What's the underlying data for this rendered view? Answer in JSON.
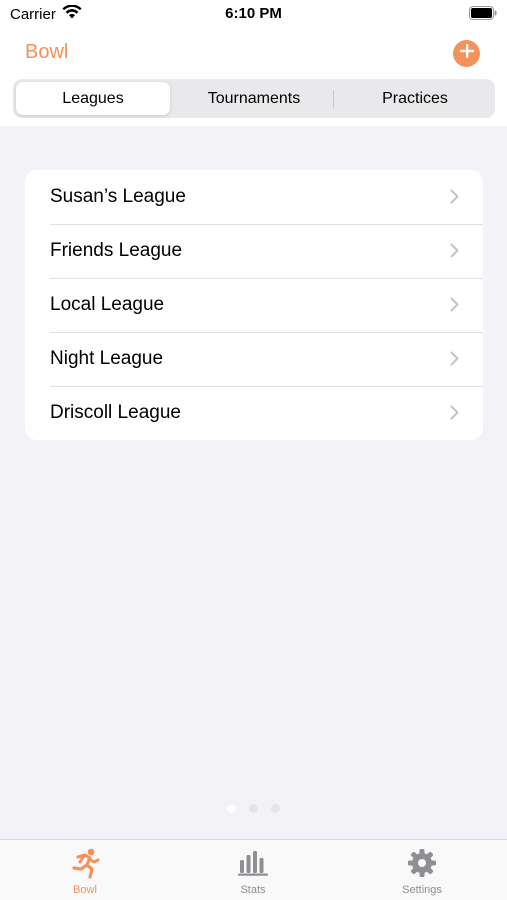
{
  "status_bar": {
    "carrier": "Carrier",
    "time": "6:10 PM"
  },
  "nav": {
    "title": "Bowl",
    "add_icon": "plus-circle-icon"
  },
  "segments": [
    {
      "label": "Leagues",
      "selected": true
    },
    {
      "label": "Tournaments",
      "selected": false
    },
    {
      "label": "Practices",
      "selected": false
    }
  ],
  "leagues": [
    {
      "label": "Susan’s League"
    },
    {
      "label": "Friends League"
    },
    {
      "label": "Local League"
    },
    {
      "label": "Night League"
    },
    {
      "label": "Driscoll League"
    }
  ],
  "page_indicator": {
    "count": 3,
    "current": 1
  },
  "tabs": [
    {
      "label": "Bowl",
      "icon": "runner-icon",
      "selected": true
    },
    {
      "label": "Stats",
      "icon": "bar-chart-icon",
      "selected": false
    },
    {
      "label": "Settings",
      "icon": "gear-icon",
      "selected": false
    }
  ],
  "colors": {
    "accent": "#f5915a",
    "inactive_tab": "#8e8e93",
    "background": "#f2f2f7"
  }
}
